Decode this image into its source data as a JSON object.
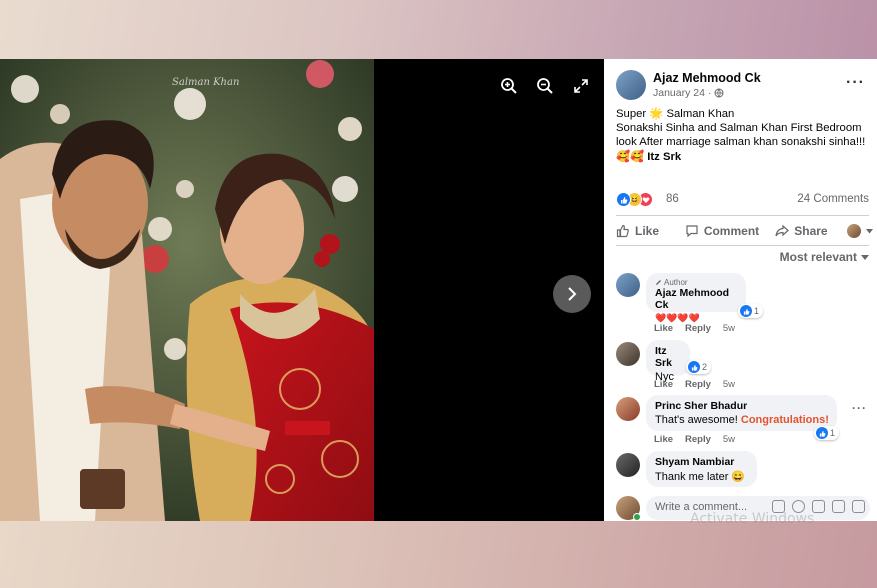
{
  "viewer": {
    "photo_watermark": "Salman Khan",
    "zoom_in_label": "zoom in",
    "zoom_out_label": "zoom out",
    "fullscreen_label": "fullscreen"
  },
  "post": {
    "author": "Ajaz Mehmood Ck",
    "date": "January 24",
    "text_line1": "Super 🌟 Salman Khan",
    "text_line2": "Sonakshi Sinha and Salman Khan First Bedroom look After marriage salman khan sonakshi sinha!!!🥰🥰",
    "tagged": "Itz Srk",
    "reaction_count": "86",
    "comments_count": "24 Comments"
  },
  "actions": {
    "like": "Like",
    "comment": "Comment",
    "share": "Share"
  },
  "sort_label": "Most relevant",
  "comments": [
    {
      "badge": "Author",
      "name": "Ajaz Mehmood Ck",
      "text": "❤️❤️❤️❤️",
      "reactions": "1",
      "like": "Like",
      "reply": "Reply",
      "time": "5w"
    },
    {
      "name": "Itz Srk",
      "text": "Nyc",
      "reactions": "2",
      "like": "Like",
      "reply": "Reply",
      "time": "5w"
    },
    {
      "name": "Princ Sher Bhadur",
      "text": "That's awesome!",
      "highlight": "Congratulations!",
      "reactions": "1",
      "like": "Like",
      "reply": "Reply",
      "time": "5w"
    },
    {
      "name": "Shyam Nambiar",
      "text": "Thank me later 😄"
    }
  ],
  "write_placeholder": "Write a comment...",
  "activate_watermark": "Activate Windows",
  "colors": {
    "accent": "#1877f2",
    "highlight": "#e4532d",
    "text_secondary": "#65676b"
  }
}
